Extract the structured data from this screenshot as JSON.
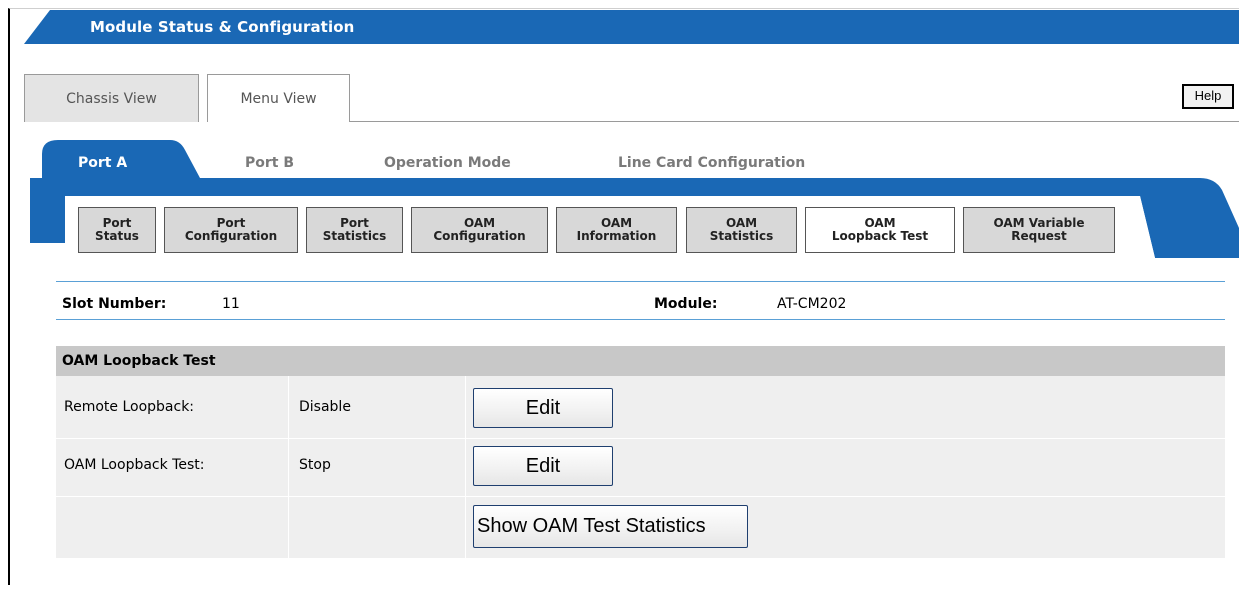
{
  "header": {
    "title": "Module Status & Configuration"
  },
  "view_tabs": [
    {
      "label": "Chassis View",
      "active": false
    },
    {
      "label": "Menu View",
      "active": true
    }
  ],
  "help_label": "Help",
  "port_tabs": [
    {
      "label": "Port A",
      "active": true
    },
    {
      "label": "Port B",
      "active": false
    },
    {
      "label": "Operation Mode",
      "active": false
    },
    {
      "label": "Line Card Configuration",
      "active": false
    }
  ],
  "sub_tabs": [
    {
      "line1": "Port",
      "line2": "Status",
      "active": false
    },
    {
      "line1": "Port",
      "line2": "Configuration",
      "active": false
    },
    {
      "line1": "Port",
      "line2": "Statistics",
      "active": false
    },
    {
      "line1": "OAM",
      "line2": "Configuration",
      "active": false
    },
    {
      "line1": "OAM",
      "line2": "Information",
      "active": false
    },
    {
      "line1": "OAM",
      "line2": "Statistics",
      "active": false
    },
    {
      "line1": "OAM",
      "line2": "Loopback Test",
      "active": true
    },
    {
      "line1": "OAM Variable",
      "line2": "Request",
      "active": false
    }
  ],
  "info": {
    "slot_label": "Slot Number:",
    "slot_value": "11",
    "module_label": "Module:",
    "module_value": "AT-CM202"
  },
  "section": {
    "title": "OAM Loopback Test",
    "rows": [
      {
        "label": "Remote Loopback:",
        "value": "Disable",
        "button": "Edit"
      },
      {
        "label": "OAM Loopback Test:",
        "value": "Stop",
        "button": "Edit"
      },
      {
        "label": "",
        "value": "",
        "button": "Show OAM Test Statistics"
      }
    ]
  },
  "colors": {
    "brand_blue": "#1a68b5",
    "section_header": "#c8c8c8",
    "row_bg": "#efefef"
  }
}
